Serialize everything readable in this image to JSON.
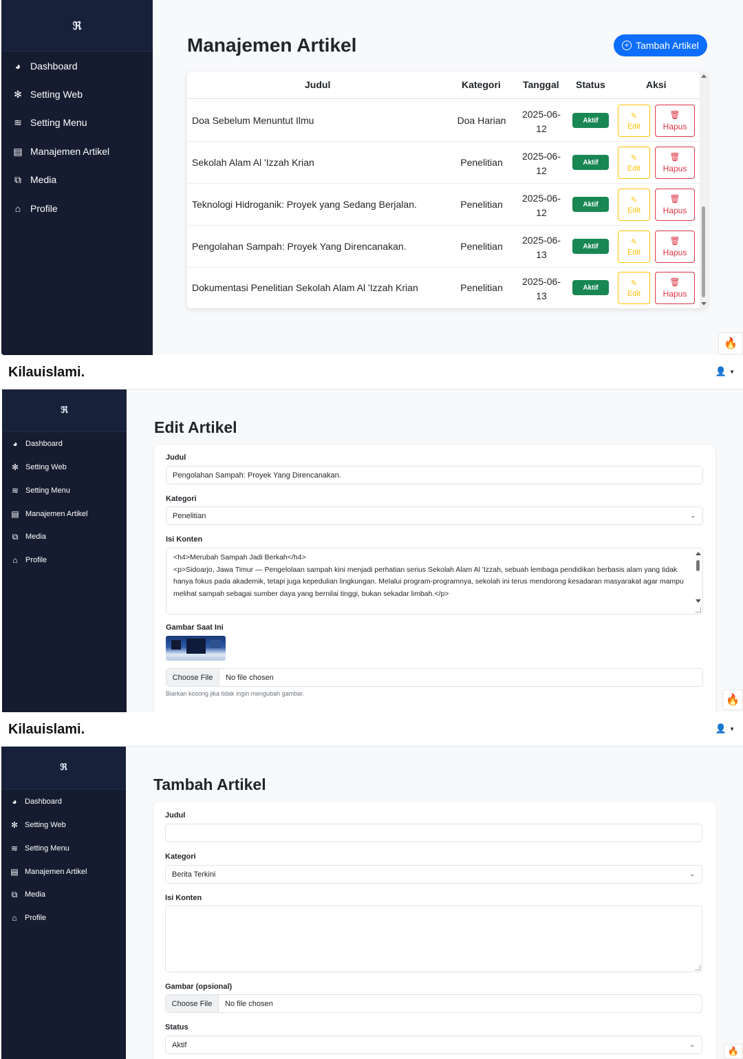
{
  "brand": "Kilauislami.",
  "logo_glyph": "ℜ",
  "sidebar": {
    "items": [
      {
        "label": "Dashboard",
        "icon": "gauge-icon"
      },
      {
        "label": "Setting Web",
        "icon": "gear-icon"
      },
      {
        "label": "Setting Menu",
        "icon": "sliders-icon"
      },
      {
        "label": "Manajemen Artikel",
        "icon": "newspaper-icon"
      },
      {
        "label": "Media",
        "icon": "images-icon"
      },
      {
        "label": "Profile",
        "icon": "home-icon"
      }
    ]
  },
  "list_page": {
    "title": "Manajemen Artikel",
    "add_button": "Tambah Artikel",
    "columns": [
      "Judul",
      "Kategori",
      "Tanggal",
      "Status",
      "Aksi"
    ],
    "rows": [
      {
        "judul": "Doa Sebelum Menuntut Ilmu",
        "kategori": "Doa Harian",
        "tanggal_1": "2025-06-",
        "tanggal_2": "12",
        "status": "Aktif"
      },
      {
        "judul": "Sekolah Alam Al 'Izzah Krian",
        "kategori": "Penelitian",
        "tanggal_1": "2025-06-",
        "tanggal_2": "12",
        "status": "Aktif"
      },
      {
        "judul": "Teknologi Hidroganik: Proyek yang Sedang Berjalan.",
        "kategori": "Penelitian",
        "tanggal_1": "2025-06-",
        "tanggal_2": "12",
        "status": "Aktif"
      },
      {
        "judul": "Pengolahan Sampah: Proyek Yang Direncanakan.",
        "kategori": "Penelitian",
        "tanggal_1": "2025-06-",
        "tanggal_2": "13",
        "status": "Aktif"
      },
      {
        "judul": "Dokumentasi Penelitian Sekolah Alam Al 'Izzah Krian",
        "kategori": "Penelitian",
        "tanggal_1": "2025-06-",
        "tanggal_2": "13",
        "status": "Aktif"
      }
    ],
    "edit_label": "Edit",
    "delete_label": "Hapus"
  },
  "edit_page": {
    "title": "Edit Artikel",
    "judul_label": "Judul",
    "judul_value": "Pengolahan Sampah: Proyek Yang Direncanakan.",
    "kategori_label": "Kategori",
    "kategori_value": "Penelitian",
    "konten_label": "Isi Konten",
    "konten_line1": "<h4>Merubah Sampah Jadi Berkah</h4>",
    "konten_line2": "<p>Sidoarjo, Jawa Timur — Pengelolaan sampah kini menjadi perhatian serius Sekolah Alam Al 'Izzah, sebuah lembaga pendidikan berbasis alam yang tidak hanya fokus pada akademik, tetapi juga kepedulian lingkungan. Melalui program-programnya, sekolah ini terus mendorong kesadaran masyarakat agar mampu melihat sampah sebagai sumber daya yang bernilai tinggi, bukan sekadar limbah.</p>",
    "gambar_label": "Gambar Saat Ini",
    "file_button": "Choose File",
    "file_status": "No file chosen",
    "help_text": "Biarkan kosong jika tidak ingin mengubah gambar."
  },
  "add_page": {
    "title": "Tambah Artikel",
    "judul_label": "Judul",
    "judul_value": "",
    "kategori_label": "Kategori",
    "kategori_value": "Berita Terkini",
    "konten_label": "Isi Konten",
    "gambar_label": "Gambar (opsional)",
    "file_button": "Choose File",
    "file_status": "No file chosen",
    "status_label": "Status",
    "status_value": "Aktif"
  },
  "colors": {
    "sidebar": "#151c30",
    "primary": "#0d6efd",
    "success": "#198754",
    "warning": "#ffc107",
    "danger": "#dc3545"
  }
}
